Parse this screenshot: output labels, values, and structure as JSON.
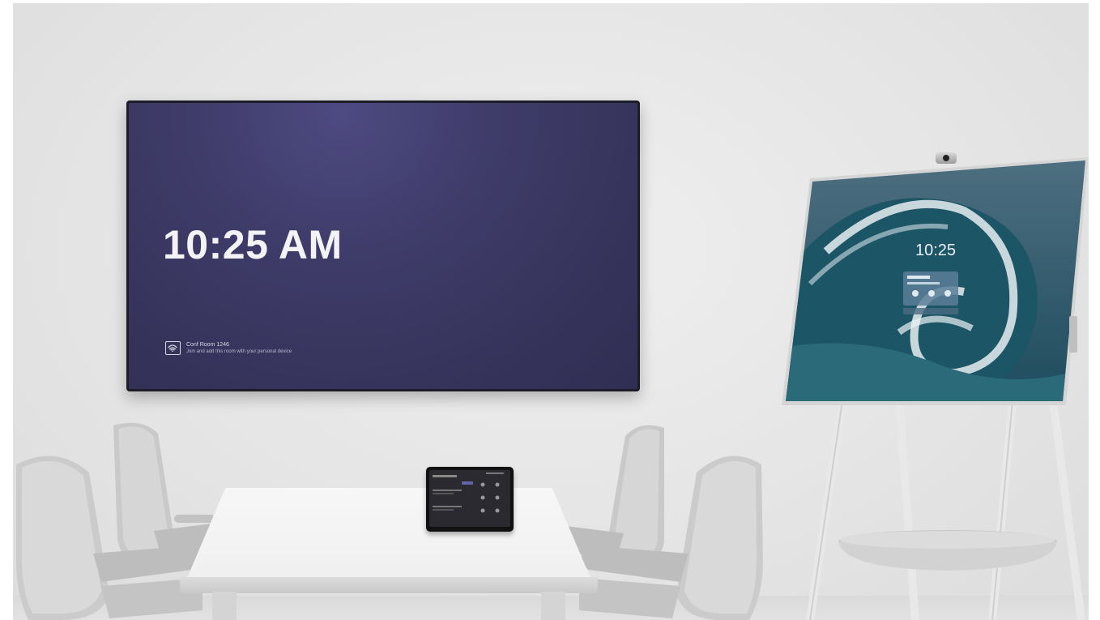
{
  "tv": {
    "time": "10:25 AM",
    "room_name": "Conf Room 1246",
    "room_hint": "Join and add this room with your personal device"
  },
  "hub": {
    "time": "10:25"
  },
  "icons": {
    "cast": "cast-icon"
  },
  "colors": {
    "wall": "#e6e6e6",
    "tv_screen": "#3f3c6a",
    "wave": "#1f5a6a"
  }
}
